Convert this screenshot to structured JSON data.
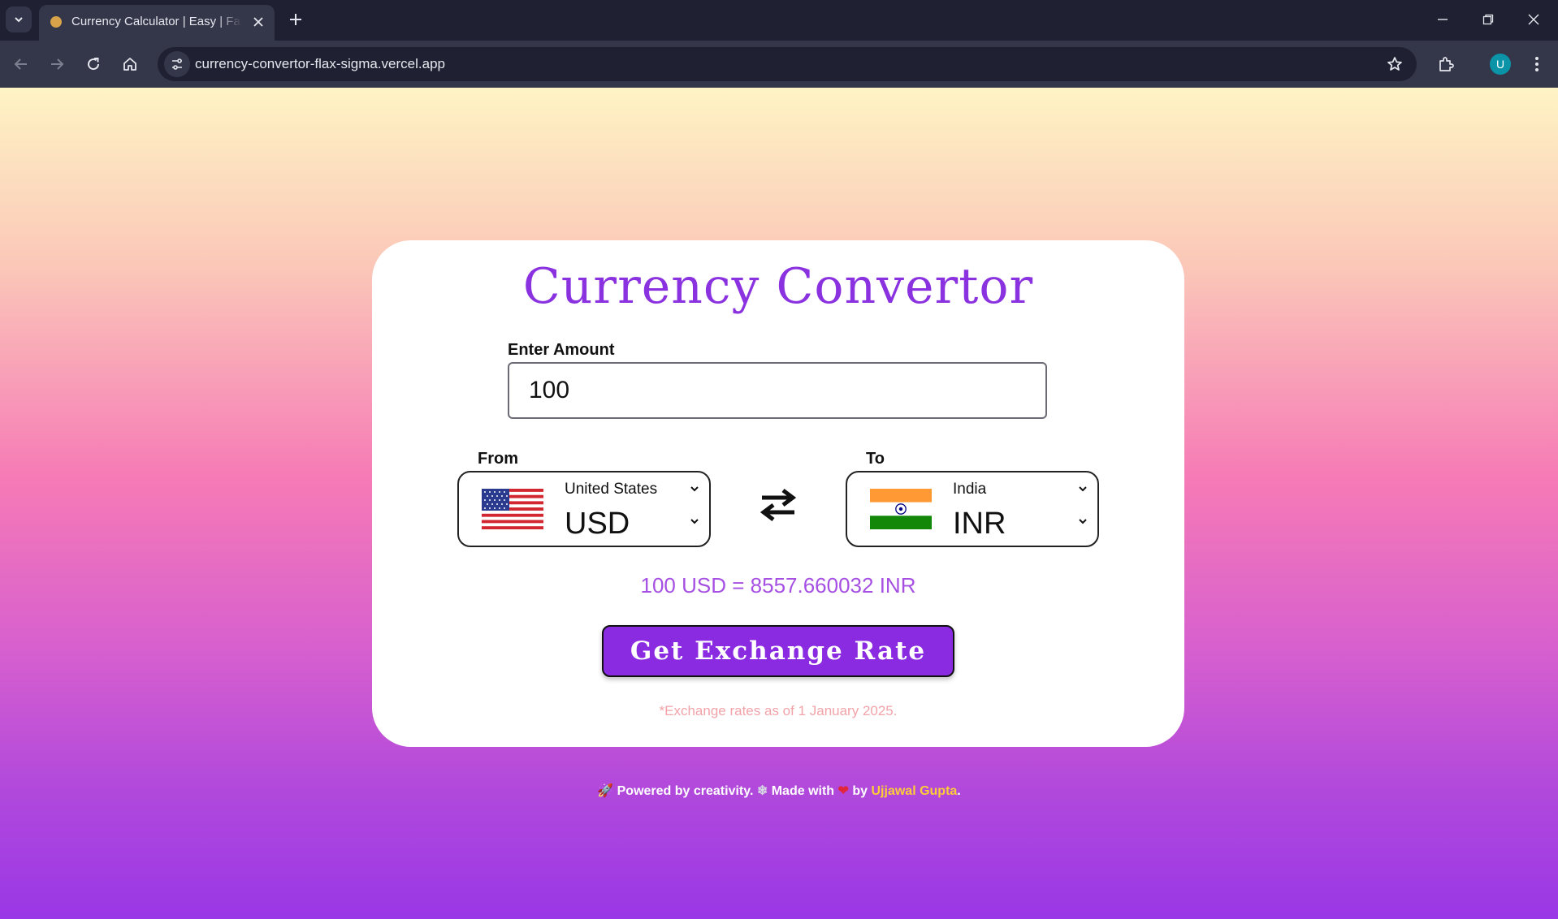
{
  "browser": {
    "tab_title": "Currency Calculator | Easy | Fast",
    "url": "currency-convertor-flax-sigma.vercel.app",
    "profile_initial": "U"
  },
  "converter": {
    "title": "Currency Convertor",
    "amount_label": "Enter Amount",
    "amount_value": "100",
    "from": {
      "label": "From",
      "country": "United States",
      "code": "USD"
    },
    "to": {
      "label": "To",
      "country": "India",
      "code": "INR"
    },
    "result": "100 USD = 8557.660032 INR",
    "button_label": "Get Exchange Rate",
    "note": "*Exchange rates as of 1 January 2025."
  },
  "footer": {
    "rocket": "🚀",
    "powered": "Powered by creativity.",
    "sparkle": "❄",
    "made_with": "Made with",
    "heart": "❤",
    "by": "by",
    "author": "Ujjawal Gupta",
    "period": "."
  },
  "colors": {
    "accent": "#8a2be2",
    "title": "#8b32e0",
    "result": "#a650e3",
    "note": "#f2a3a9",
    "author": "#fccd38"
  }
}
